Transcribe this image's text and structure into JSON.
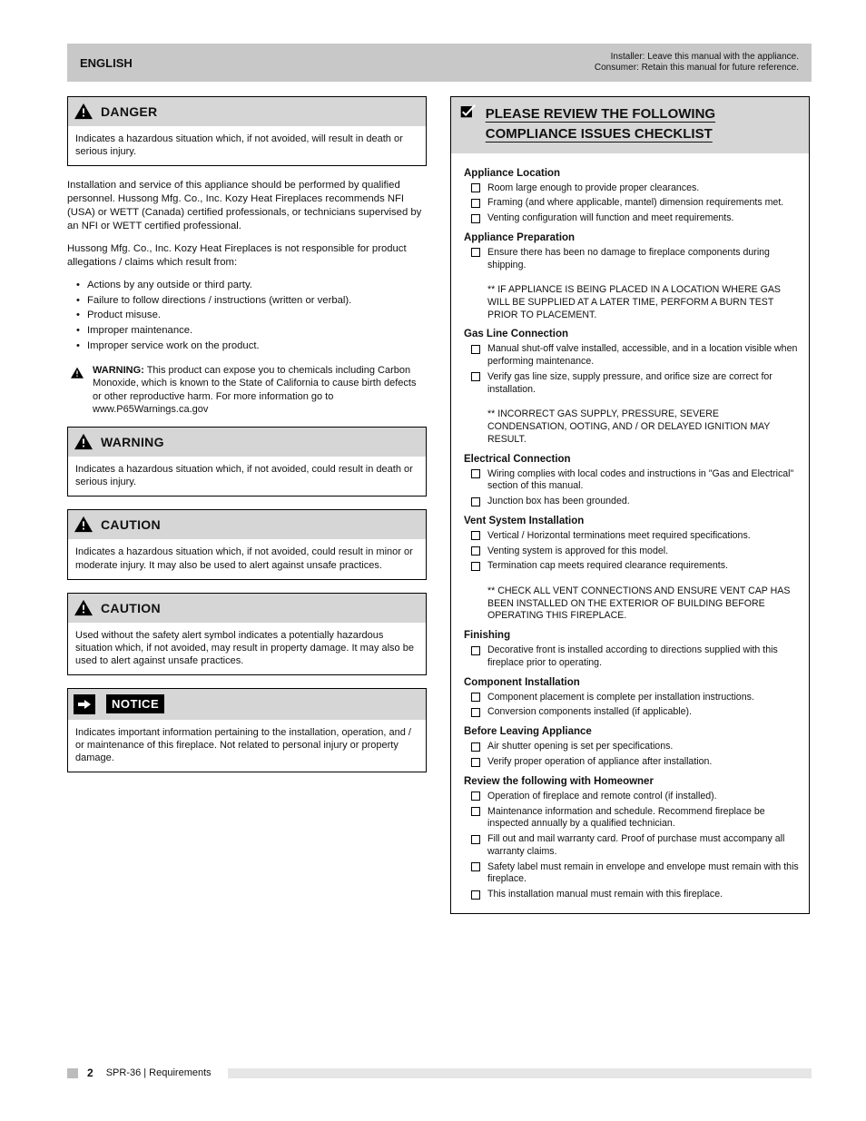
{
  "header": {
    "left": "ENGLISH",
    "right": "Installer: Leave this manual with the appliance.\nConsumer: Retain this manual for future reference."
  },
  "left": {
    "danger": {
      "label": "DANGER",
      "body": "Indicates a hazardous situation which, if not avoided, will result in death or serious injury."
    },
    "introA": "Installation and service of this appliance should be performed by qualified personnel. Hussong Mfg. Co., Inc. Kozy Heat Fireplaces recommends NFI (USA) or WETT (Canada) certified professionals, or technicians supervised by an NFI or WETT certified professional.",
    "introB": "Hussong Mfg. Co., Inc. Kozy Heat Fireplaces is not responsible for product allegations / claims which result from:",
    "introBullets": [
      "Actions by any outside or third party.",
      "Failure to follow directions / instructions (written or verbal).",
      "Product misuse.",
      "Improper maintenance.",
      "Improper service work on the product."
    ],
    "inlineWarn": {
      "bold": "WARNING:",
      "text": "This product can expose you to chemicals including Carbon Monoxide, which is known to the State of California to cause birth defects or other reproductive harm. For more information go to www.P65Warnings.ca.gov"
    },
    "warning": {
      "label": "WARNING",
      "body": "Indicates a hazardous situation which, if not avoided, could result in death or serious injury."
    },
    "caution": {
      "label": "CAUTION",
      "body": "Indicates a hazardous situation which, if not avoided, could result in minor or moderate injury. It may also be used to alert against unsafe practices."
    },
    "caution2": {
      "label": "CAUTION",
      "body": "Used without the safety alert symbol indicates a potentially hazardous situation which, if not avoided, may result in property damage. It may also be used to alert against unsafe practices."
    },
    "notice": {
      "label": "NOTICE",
      "body": "Indicates important information pertaining to the installation, operation, and / or maintenance of this fireplace. Not related to personal injury or property damage."
    }
  },
  "checklist": {
    "title": "PLEASE REVIEW THE FOLLOWING COMPLIANCE ISSUES CHECKLIST",
    "groups": [
      {
        "title": "Appliance Location",
        "items": [
          "Room large enough to provide proper clearances.",
          "Framing (and where applicable, mantel) dimension requirements met.",
          "Venting configuration will function and meet requirements."
        ]
      },
      {
        "title": "Appliance Preparation",
        "items": [
          "Ensure there has been no damage to fireplace components during shipping.\n\n** IF APPLIANCE IS BEING PLACED IN A LOCATION WHERE GAS WILL BE SUPPLIED AT A LATER TIME, PERFORM A BURN TEST PRIOR TO PLACEMENT."
        ]
      },
      {
        "title": "Gas Line Connection",
        "items": [
          "Manual shut-off valve installed, accessible, and in a location visible when performing maintenance.",
          "Verify gas line size, supply pressure, and orifice size are correct for installation.\n\n** INCORRECT GAS SUPPLY, PRESSURE, SEVERE CONDENSATION, OOTING, AND / OR DELAYED IGNITION MAY RESULT."
        ]
      },
      {
        "title": "Electrical Connection",
        "items": [
          "Wiring complies with local codes and instructions in \"Gas and Electrical\" section of this manual.",
          "Junction box has been grounded."
        ]
      },
      {
        "title": "Vent System Installation",
        "items": [
          "Vertical / Horizontal terminations meet required specifications.",
          "Venting system is approved for this model.",
          "Termination cap meets required clearance requirements.\n\n** CHECK ALL VENT CONNECTIONS AND ENSURE VENT CAP HAS BEEN INSTALLED ON THE EXTERIOR OF BUILDING BEFORE OPERATING THIS FIREPLACE."
        ]
      },
      {
        "title": "Finishing",
        "items": [
          "Decorative front is installed according to directions supplied with this fireplace prior to operating."
        ]
      },
      {
        "title": "Component Installation",
        "items": [
          "Component placement is complete per installation instructions.",
          "Conversion components installed (if applicable)."
        ]
      },
      {
        "title": "Before Leaving Appliance",
        "items": [
          "Air shutter opening is set per specifications.",
          "Verify proper operation of appliance after installation."
        ]
      },
      {
        "title": "Review the following with Homeowner",
        "items": [
          "Operation of fireplace and remote control (if installed).",
          "Maintenance information and schedule. Recommend fireplace be inspected annually by a qualified technician.",
          "Fill out and mail warranty card. Proof of purchase must accompany all warranty claims.",
          "Safety label must remain in envelope and envelope must remain with this fireplace.",
          "This installation manual must remain with this fireplace."
        ]
      }
    ]
  },
  "footer": {
    "pageNum": "2",
    "tag": "SPR-36 | Requirements"
  }
}
